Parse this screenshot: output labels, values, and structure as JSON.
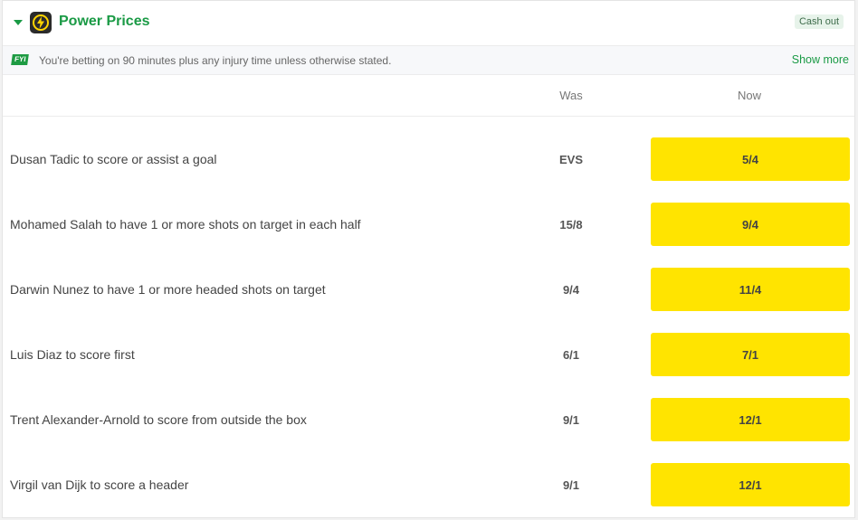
{
  "header": {
    "title": "Power Prices",
    "cashout_label": "Cash out",
    "icon": "lightning-bolt-icon",
    "accent_color": "#1a9a45"
  },
  "info_bar": {
    "badge": "FYI",
    "text": "You're betting on 90 minutes plus any injury time unless otherwise stated.",
    "show_more": "Show more"
  },
  "columns": {
    "was": "Was",
    "now": "Now"
  },
  "rows": [
    {
      "selection": "Dusan Tadic to score or assist a goal",
      "was": "EVS",
      "now": "5/4"
    },
    {
      "selection": "Mohamed Salah to have 1 or more shots on target in each half",
      "was": "15/8",
      "now": "9/4"
    },
    {
      "selection": "Darwin Nunez to have 1 or more headed shots on target",
      "was": "9/4",
      "now": "11/4"
    },
    {
      "selection": "Luis Diaz to score first",
      "was": "6/1",
      "now": "7/1"
    },
    {
      "selection": "Trent Alexander-Arnold to score from outside the box",
      "was": "9/1",
      "now": "12/1"
    },
    {
      "selection": "Virgil van Dijk to score a header",
      "was": "9/1",
      "now": "12/1"
    }
  ],
  "price_button_color": "#ffe400"
}
